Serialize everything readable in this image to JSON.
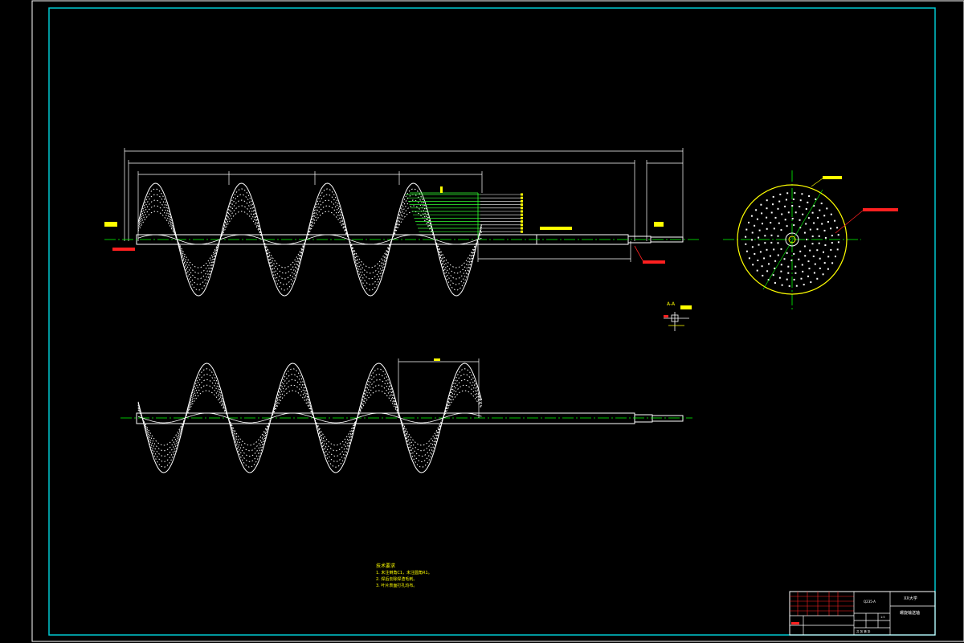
{
  "colors": {
    "background": "#000000",
    "frame": "#00c8d0",
    "outline": "#ffffff",
    "dimension": "#ffffff",
    "centerline": "#00ff00",
    "annotation": "#ffff00",
    "leader": "#ff2020",
    "hatch": "#33ff33",
    "titleblock_red": "#ff2020"
  },
  "notes": {
    "heading": "技术要求",
    "items": [
      "1. 未注倒角C1，未注圆角R1。",
      "2. 焊后去除焊渣毛刺。",
      "3. 叶片表面打孔均布。"
    ]
  },
  "title_block": {
    "material": "Q235-A",
    "school": "XX大学",
    "drawing_name": "螺旋输送轴",
    "scale": "1:5",
    "sheet": "共 张 第 张"
  },
  "section_label": "A-A"
}
